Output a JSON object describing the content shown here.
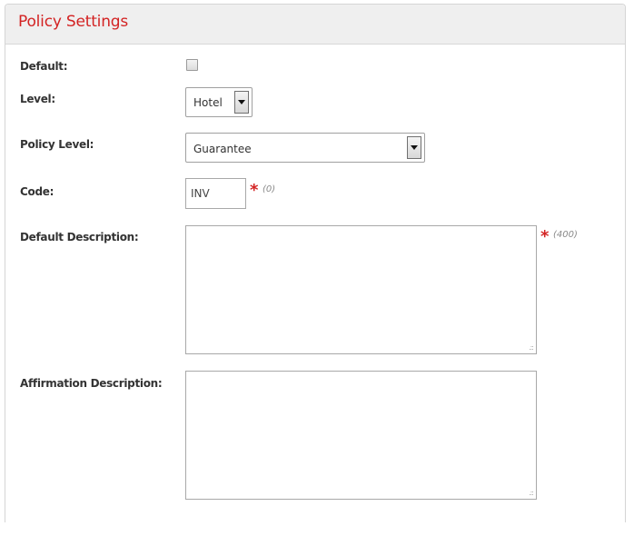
{
  "panel": {
    "title": "Policy Settings"
  },
  "fields": {
    "default": {
      "label": "Default:",
      "checked": false
    },
    "level": {
      "label": "Level:",
      "value": "Hotel"
    },
    "policy_level": {
      "label": "Policy Level:",
      "value": "Guarantee"
    },
    "code": {
      "label": "Code:",
      "value": "INV",
      "required": "*",
      "count": "(0)"
    },
    "default_description": {
      "label": "Default Description:",
      "value": "",
      "required": "*",
      "count": "(400)"
    },
    "affirmation_description": {
      "label": "Affirmation Description:",
      "value": ""
    }
  },
  "colors": {
    "accent": "#d32323",
    "header_bg": "#efefef"
  },
  "icons": {
    "dropdown": "chevron-down-icon",
    "resize": "resize-grip-icon"
  }
}
